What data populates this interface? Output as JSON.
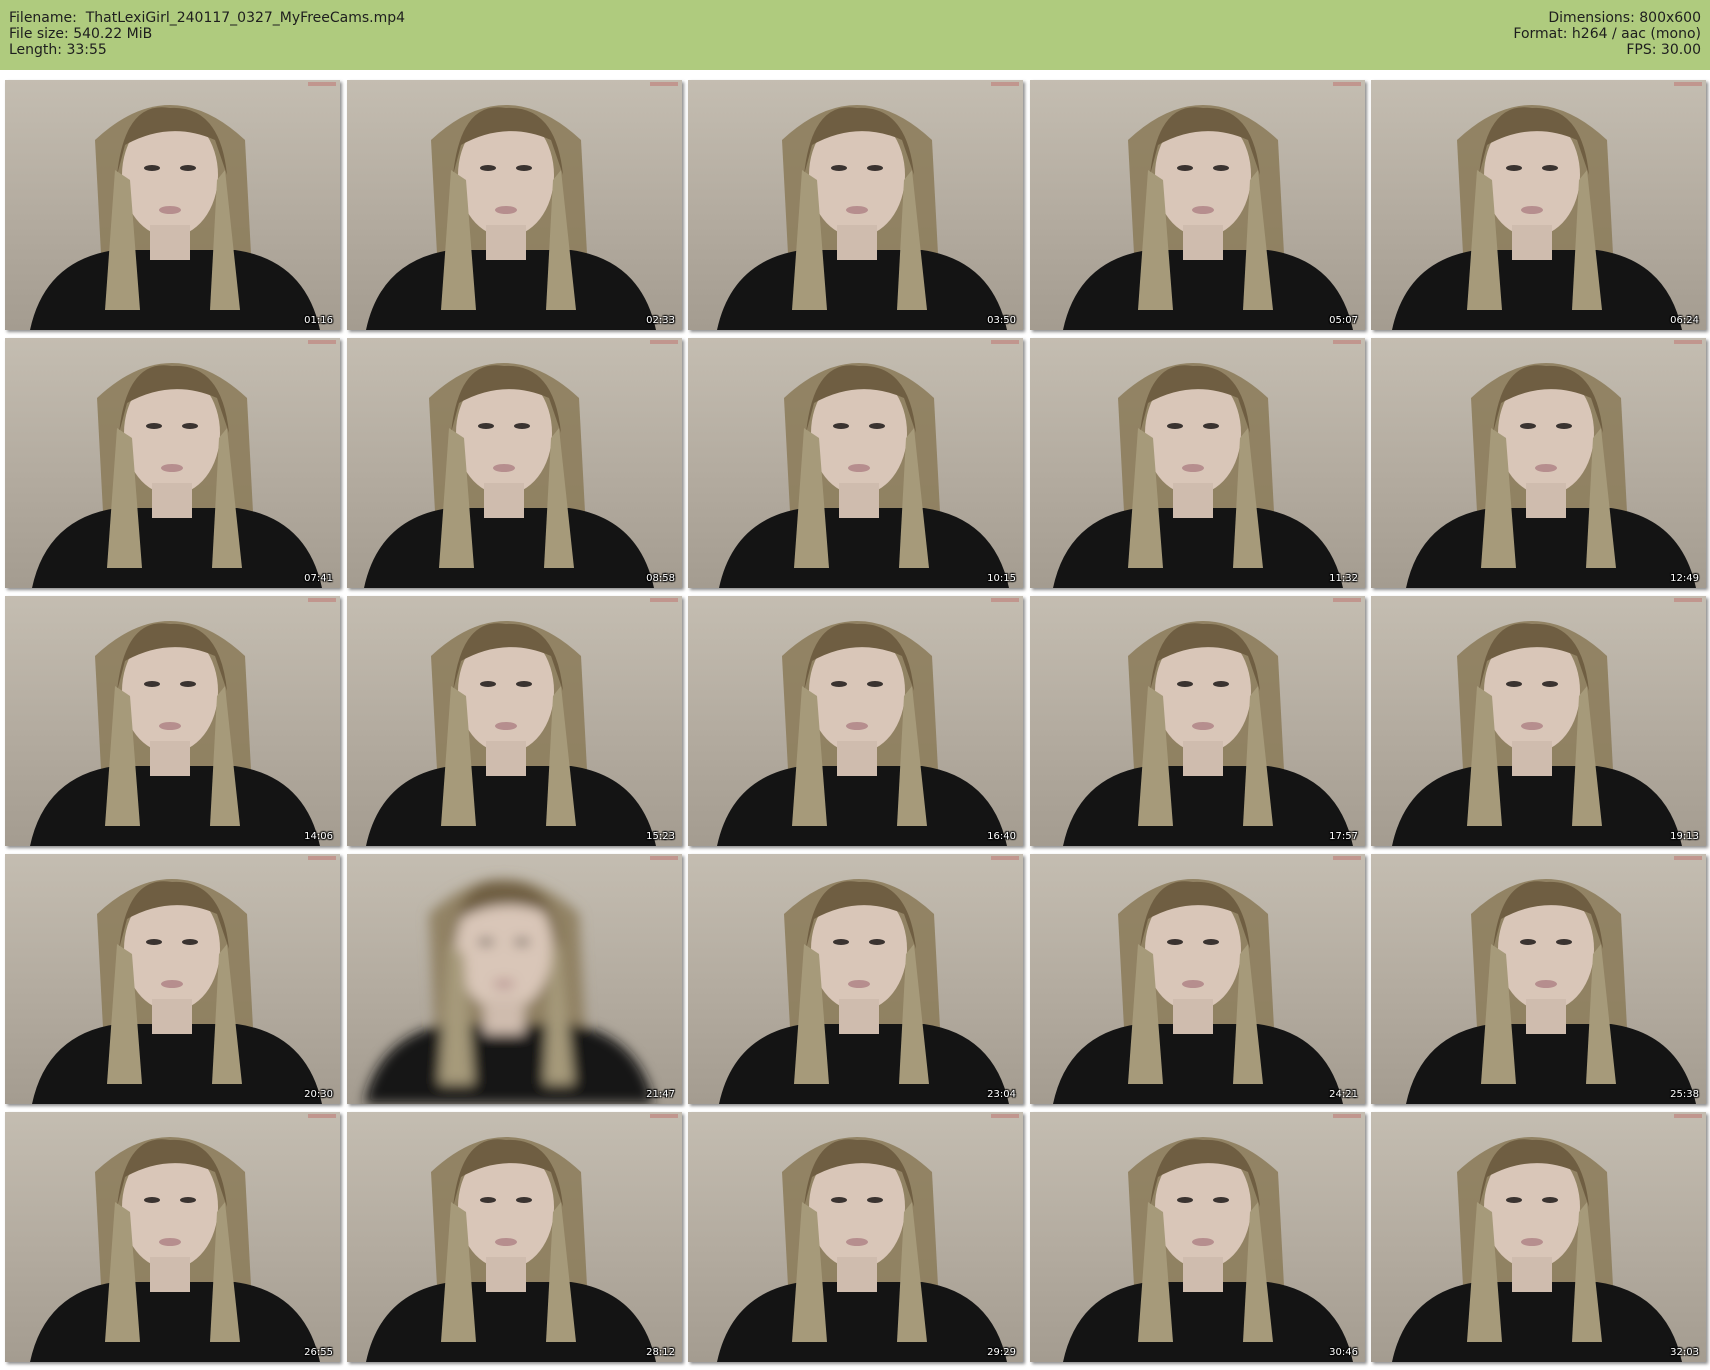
{
  "header": {
    "filename": "Filename:  ThatLexiGirl_240117_0327_MyFreeCams.mp4",
    "filesize": "File size: 540.22 MiB",
    "length": "Length: 33:55",
    "dimensions": "Dimensions: 800x600",
    "format": "Format: h264 / aac (mono)",
    "fps": "FPS: 30.00"
  },
  "colors": {
    "header_bg": "#afcb7e"
  },
  "thumbnails": [
    {
      "timestamp": "01:16"
    },
    {
      "timestamp": "02:33"
    },
    {
      "timestamp": "03:50"
    },
    {
      "timestamp": "05:07"
    },
    {
      "timestamp": "06:24"
    },
    {
      "timestamp": "07:41"
    },
    {
      "timestamp": "08:58"
    },
    {
      "timestamp": "10:15"
    },
    {
      "timestamp": "11:32"
    },
    {
      "timestamp": "12:49"
    },
    {
      "timestamp": "14:06"
    },
    {
      "timestamp": "15:23"
    },
    {
      "timestamp": "16:40"
    },
    {
      "timestamp": "17:57"
    },
    {
      "timestamp": "19:13"
    },
    {
      "timestamp": "20:30"
    },
    {
      "timestamp": "21:47"
    },
    {
      "timestamp": "23:04"
    },
    {
      "timestamp": "24:21"
    },
    {
      "timestamp": "25:38"
    },
    {
      "timestamp": "26:55"
    },
    {
      "timestamp": "28:12"
    },
    {
      "timestamp": "29:29"
    },
    {
      "timestamp": "30:46"
    },
    {
      "timestamp": "32:03"
    }
  ]
}
